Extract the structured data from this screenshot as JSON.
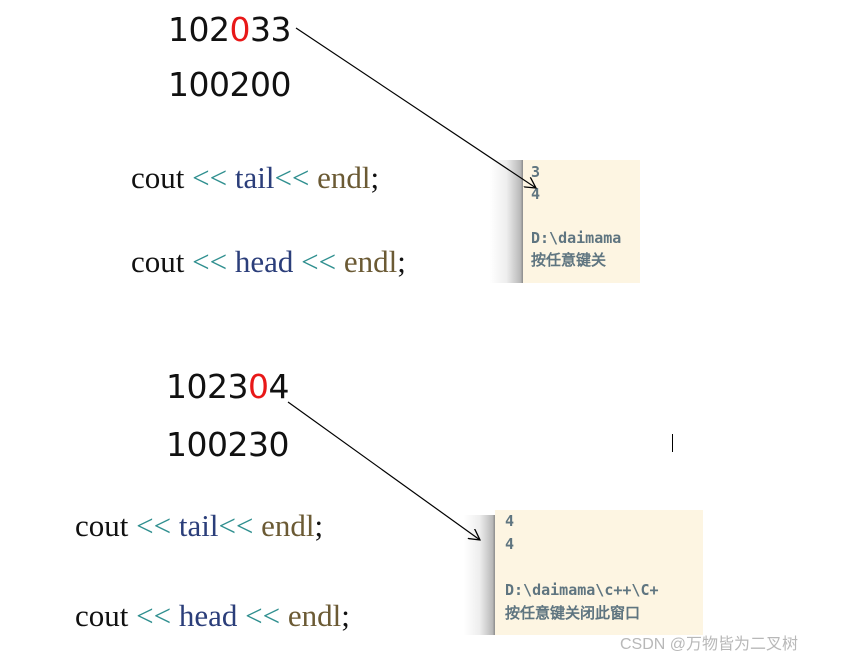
{
  "example1": {
    "number_top": {
      "before": "102",
      "highlight": "0",
      "after": "33"
    },
    "number_bottom": "100200",
    "code": [
      {
        "cout": "cout",
        "op1": "<<",
        "var": "tail",
        "op2": "<<",
        "endl": "endl",
        "semi": ";"
      },
      {
        "cout": "cout",
        "op1": "<<",
        "var": "head",
        "op2": "<<",
        "endl": "endl",
        "semi": ";"
      }
    ],
    "console": [
      "3",
      "4",
      "",
      "D:\\daimama",
      "按任意键关"
    ]
  },
  "example2": {
    "number_top": {
      "before": "1023",
      "highlight": "0",
      "after": "4"
    },
    "number_bottom": "100230",
    "code": [
      {
        "cout": "cout",
        "op1": "<<",
        "var": "tail",
        "op2": "<<",
        "endl": "endl",
        "semi": ";"
      },
      {
        "cout": "cout",
        "op1": "<<",
        "var": "head",
        "op2": "<<",
        "endl": "endl",
        "semi": ";"
      }
    ],
    "console": [
      "4",
      "4",
      "",
      "D:\\daimama\\c++\\C+",
      "按任意键关闭此窗口"
    ]
  },
  "watermark": "CSDN @万物皆为二叉树",
  "colors": {
    "highlight": "#e81818",
    "operator": "#2f8f8f",
    "variable": "#2b3e7a",
    "endl": "#6b5a34",
    "console_bg": "#fdf5e2",
    "console_text": "#5f7580"
  }
}
